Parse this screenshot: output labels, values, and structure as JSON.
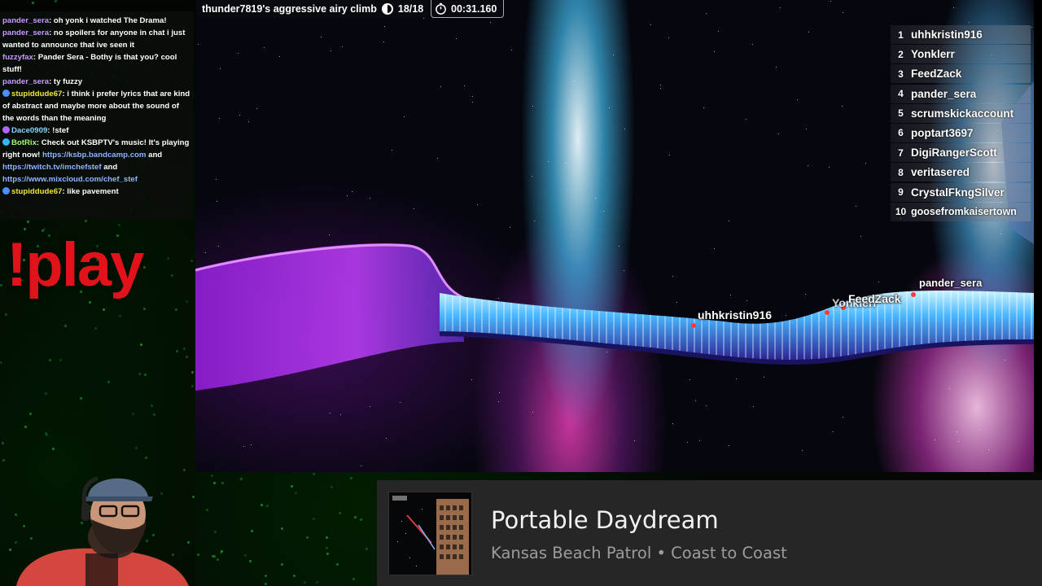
{
  "hud": {
    "track_title": "thunder7819's aggressive airy climb",
    "checkpoint": "18/18",
    "timer": "00:31.160"
  },
  "chat": [
    {
      "user": "pander_sera",
      "color": "#c79bff",
      "badge": "",
      "text": ": oh yonk i watched The Drama!"
    },
    {
      "user": "pander_sera",
      "color": "#c79bff",
      "badge": "",
      "text": ": no spoilers for anyone in chat i just wanted to announce that ive seen it"
    },
    {
      "user": "fuzzyfax",
      "color": "#c79bff",
      "badge": "",
      "text": ": Pander Sera - Bothy is that you? cool stuff!"
    },
    {
      "user": "pander_sera",
      "color": "#c79bff",
      "badge": "",
      "text": ": ty fuzzy"
    },
    {
      "user": "stupiddude67",
      "color": "#f0e442",
      "badge": "#4a90ff",
      "text": ": i think i prefer lyrics that are kind of abstract and maybe more about the sound of the words than the meaning"
    },
    {
      "user": "Dace0909",
      "color": "#7fd7ff",
      "badge": "#b266ff",
      "text": ": !stef"
    },
    {
      "user": "BotRix",
      "color": "#9cff6b",
      "badge": "#2fb8ff",
      "text": ": Check out KSBPTV's music! It's playing right now! ",
      "links": [
        "https://ksbp.bandcamp.com",
        "https://twitch.tv/imchefstef",
        "https://www.mixcloud.com/chef_stef"
      ],
      "joins": [
        " and ",
        " and ",
        ""
      ]
    },
    {
      "user": "stupiddude67",
      "color": "#f0e442",
      "badge": "#4a90ff",
      "text": ": like pavement"
    }
  ],
  "play_command": "!play",
  "leaderboard": [
    {
      "rank": "1",
      "name": "uhhkristin916"
    },
    {
      "rank": "2",
      "name": "Yonklerr"
    },
    {
      "rank": "3",
      "name": "FeedZack"
    },
    {
      "rank": "4",
      "name": "pander_sera"
    },
    {
      "rank": "5",
      "name": "scrumskickaccount"
    },
    {
      "rank": "6",
      "name": "poptart3697"
    },
    {
      "rank": "7",
      "name": "DigiRangerScott"
    },
    {
      "rank": "8",
      "name": "veritasered"
    },
    {
      "rank": "9",
      "name": "CrystalFkngSilver"
    },
    {
      "rank": "10",
      "name": "goosefromkaisertown"
    }
  ],
  "player_tags": {
    "tag1": "uhhkristin916",
    "tag2": "Yonklerr",
    "tag3": "FeedZack",
    "tag4": "pander_sera"
  },
  "now_playing": {
    "title": "Portable Daydream",
    "artist": "Kansas Beach Patrol",
    "separator": "•",
    "album": "Coast to Coast"
  },
  "colors": {
    "play_red": "#e1131a",
    "link_blue": "#8fb4ff",
    "card_bg": "#262626"
  }
}
